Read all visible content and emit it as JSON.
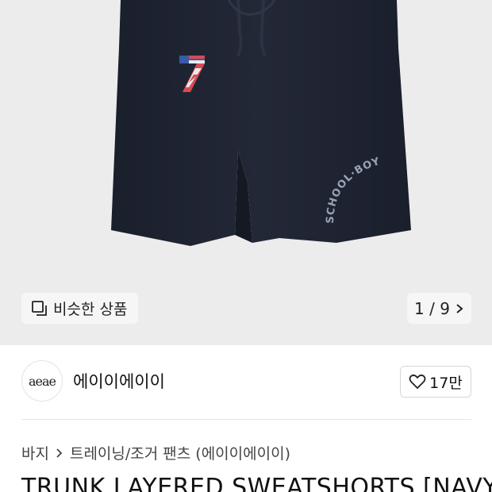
{
  "gallery": {
    "similar_label": "비슷한 상품",
    "counter": "1 / 9",
    "image_print": {
      "number": "7",
      "arc_text": "SCHOOL·BOY"
    },
    "colors": {
      "background": "#ececec",
      "shorts": "#1e2331"
    }
  },
  "brand": {
    "logo_text": "aeae",
    "name": "에이이에이이",
    "like_count": "17만"
  },
  "breadcrumb": {
    "items": [
      "바지",
      "트레이닝/조거 팬츠 (에이이에이이)"
    ]
  },
  "product": {
    "title": "TRUNK LAYERED SWEATSHORTS [NAVY]"
  }
}
